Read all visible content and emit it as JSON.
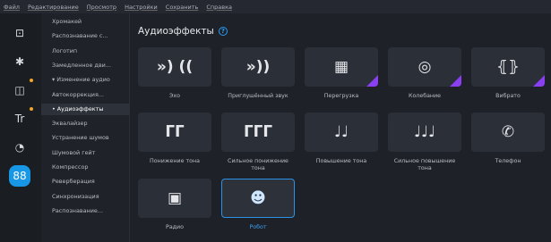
{
  "menu": [
    "Файл",
    "Редактирование",
    "Просмотр",
    "Настройки",
    "Сохранить",
    "Справка"
  ],
  "rail": [
    {
      "icon": "import-icon",
      "glyph": "⊡",
      "dot": false
    },
    {
      "icon": "magic-wand-icon",
      "glyph": "✱",
      "dot": false
    },
    {
      "icon": "transitions-icon",
      "glyph": "◫",
      "dot": true
    },
    {
      "icon": "titles-icon",
      "glyph": "Tr",
      "dot": true
    },
    {
      "icon": "stickers-icon",
      "glyph": "◔",
      "dot": false
    },
    {
      "icon": "more-tools-icon",
      "glyph": "88",
      "dot": false,
      "active": true
    }
  ],
  "sidebar": {
    "items": [
      "Хромакей",
      "Распознавание с...",
      "Логотип",
      "Замедленное дви...",
      "▾ Изменение аудио",
      "Автокоррекция...",
      "• Аудиоэффекты",
      "Эквалайзер",
      "Устранение шумов",
      "Шумовой гейт",
      "Компрессор",
      "Реверберация",
      "Синхронизация",
      "Распознавание..."
    ],
    "selected_index": 6
  },
  "main": {
    "title": "Аудиоэффекты",
    "help": "?",
    "effects": [
      {
        "label": "Эхо",
        "icon": "echo-icon",
        "glyph": "»)  ((",
        "premium": false,
        "selected": false
      },
      {
        "label": "Приглушённый звук",
        "icon": "muffled-sound-icon",
        "glyph": "»))",
        "premium": false,
        "selected": false
      },
      {
        "label": "Перегрузка",
        "icon": "overdrive-icon",
        "glyph": "▦",
        "premium": true,
        "selected": false
      },
      {
        "label": "Колебание",
        "icon": "wobble-icon",
        "glyph": "◎",
        "premium": true,
        "selected": false
      },
      {
        "label": "Вибрато",
        "icon": "vibrato-icon",
        "glyph": "⦃⦄",
        "premium": true,
        "selected": false
      },
      {
        "label": "Понижение тона",
        "icon": "pitch-down-icon",
        "glyph": "ᒥᒥ",
        "premium": false,
        "selected": false
      },
      {
        "label": "Сильное понижение тона",
        "icon": "strong-pitch-down-icon",
        "glyph": "ᒥᒥᒥ",
        "premium": false,
        "selected": false
      },
      {
        "label": "Повышение тона",
        "icon": "pitch-up-icon",
        "glyph": "♩♩",
        "premium": false,
        "selected": false
      },
      {
        "label": "Сильное повышение тона",
        "icon": "strong-pitch-up-icon",
        "glyph": "♩♩♩",
        "premium": false,
        "selected": false
      },
      {
        "label": "Телефон",
        "icon": "phone-icon",
        "glyph": "✆",
        "premium": false,
        "selected": false
      },
      {
        "label": "Радио",
        "icon": "radio-icon",
        "glyph": "▣",
        "premium": false,
        "selected": false
      },
      {
        "label": "Робот",
        "icon": "robot-icon",
        "glyph": "☻",
        "premium": false,
        "selected": true
      }
    ]
  }
}
